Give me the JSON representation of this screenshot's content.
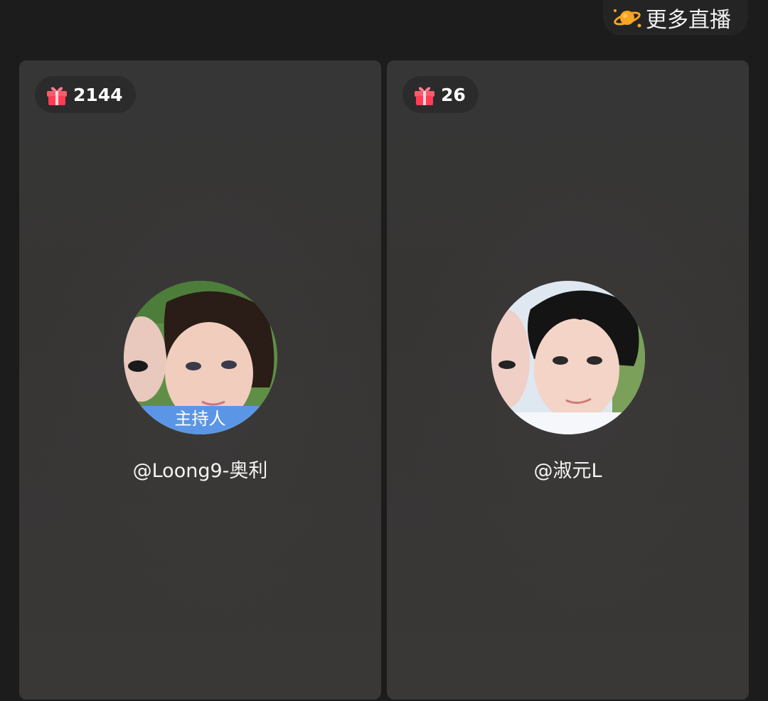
{
  "header": {
    "more_live_label": "更多直播",
    "more_live_icon": "planet-icon"
  },
  "panels": [
    {
      "gift_count": "2144",
      "gift_icon": "gift-icon",
      "username": "@Loong9-奥利",
      "host_tag": "主持人",
      "avatar_colors": [
        "#6aa84f",
        "#2d1f1a",
        "#f1d1c3"
      ]
    },
    {
      "gift_count": "26",
      "gift_icon": "gift-icon",
      "username": "@淑元L",
      "avatar_colors": [
        "#dfe8f0",
        "#151515",
        "#f0cfbf"
      ]
    }
  ]
}
